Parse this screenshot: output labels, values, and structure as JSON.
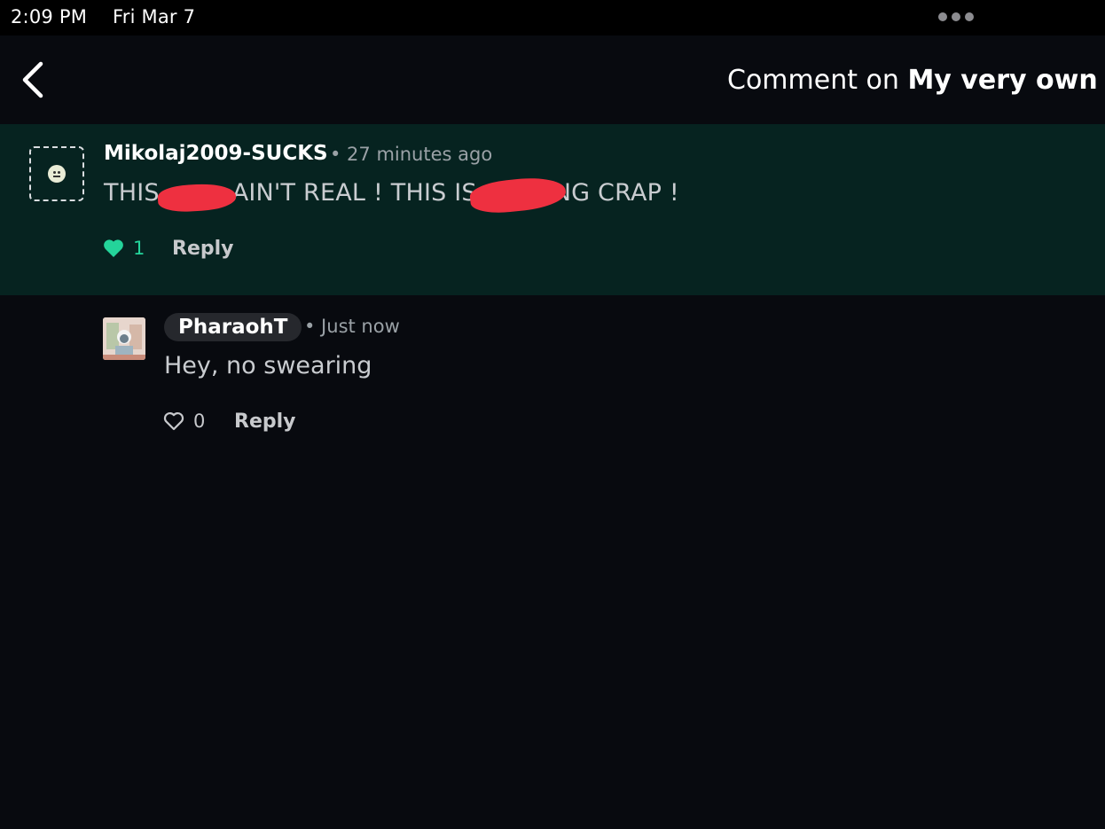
{
  "status_bar": {
    "time": "2:09 PM",
    "date": "Fri Mar 7",
    "more_icon": "ellipsis-icon"
  },
  "nav": {
    "back_icon": "chevron-left-icon",
    "title_prefix": "Comment on",
    "title_bold": "My very own p"
  },
  "comments": [
    {
      "username": "Mikolaj2009-SUCKS",
      "time": "• 27 minutes ago",
      "text_segments": [
        "THIS",
        "AIN'T REAL ! THIS IS",
        "NG CRAP !"
      ],
      "likes": "1",
      "liked": true,
      "reply_label": "Reply",
      "highlight_color": "#062320",
      "redaction_color": "#ee3040"
    },
    {
      "username": "PharaohT",
      "time": "• Just now",
      "text": "Hey, no swearing",
      "likes": "0",
      "liked": false,
      "reply_label": "Reply"
    }
  ],
  "colors": {
    "background": "#080a0f",
    "like_active": "#24d49a"
  }
}
